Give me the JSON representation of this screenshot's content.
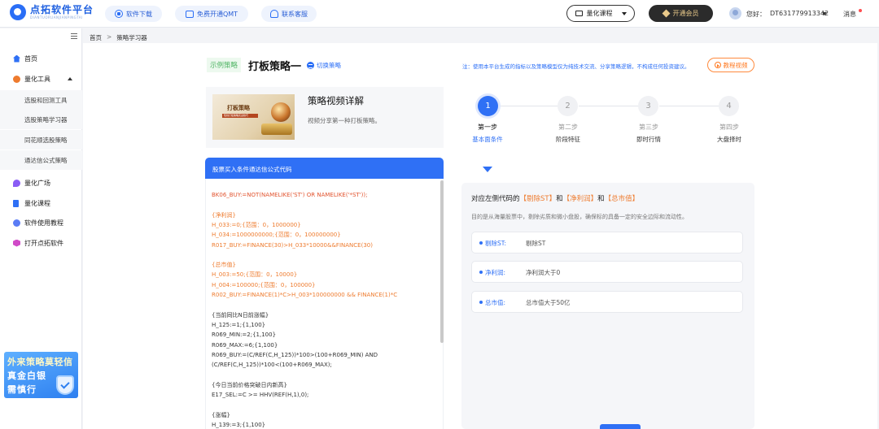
{
  "brand": {
    "name": "点拓软件平台",
    "sub": "DIANTUORUANJIANPINGTAI"
  },
  "topnav": {
    "download": "软件下载",
    "qmt": "免费开通QMT",
    "support": "联系客服",
    "course": "量化课程",
    "vip": "开通会员",
    "greeting": "您好：",
    "user_id": "DT631779913342",
    "messages": "消息"
  },
  "sidebar": {
    "items": [
      {
        "label": "首页",
        "icon": "home-icon"
      },
      {
        "label": "量化工具",
        "icon": "tools-icon"
      },
      {
        "label": "量化广场",
        "icon": "square-icon"
      },
      {
        "label": "量化课程",
        "icon": "book-icon"
      },
      {
        "label": "软件使用教程",
        "icon": "tutorial-icon"
      },
      {
        "label": "打开点拓软件",
        "icon": "open-app-icon"
      }
    ],
    "subitems": [
      "选股和回测工具",
      "选股策略学习器",
      "同花顺选股策略",
      "通达信公式策略"
    ],
    "promo": [
      "外来策略莫轻信",
      "真金白银",
      "需慎行"
    ]
  },
  "breadcrumb": {
    "home": "首页",
    "sep": ">",
    "current": "策略学习器"
  },
  "strategy": {
    "tag": "示例策略",
    "title": "打板策略一",
    "switch": "切换策略",
    "notice": "注：使用本平台生成的指标以及策略模型仅为纯技术交流、分享策略逻辑，不构成任何投资建议。",
    "tutorial": "教程视频"
  },
  "video": {
    "thumb_title": "打板策略",
    "thumb_sub": "短线打板策略实战技巧",
    "title": "策略视频详解",
    "desc": "视频分享第一种打板策略。"
  },
  "code": {
    "header": "股票买入条件通达信公式代码",
    "lines": [
      {
        "t": "BK06_BUY:=NOT(NAMELIKE('ST') OR NAMELIKE('*ST'));",
        "c": "red"
      },
      {
        "t": "",
        "c": "dark"
      },
      {
        "t": "{净利润}",
        "c": "org"
      },
      {
        "t": "H_033:=0;{范围：0，1000000}",
        "c": "org"
      },
      {
        "t": "H_034:=1000000000;{范围：0，100000000}",
        "c": "org"
      },
      {
        "t": "R017_BUY:=FINANCE(30)>H_033*10000&&FINANCE(30)",
        "c": "org"
      },
      {
        "t": "",
        "c": "dark"
      },
      {
        "t": "{总市值}",
        "c": "org"
      },
      {
        "t": "H_003:=50;{范围：0，10000}",
        "c": "org"
      },
      {
        "t": "H_004:=100000;{范围：0，100000}",
        "c": "org"
      },
      {
        "t": "R002_BUY:=FINANCE(1)*C>H_003*100000000 && FINANCE(1)*C",
        "c": "org"
      },
      {
        "t": "",
        "c": "dark"
      },
      {
        "t": "{当前同比N日前涨幅}",
        "c": "dark"
      },
      {
        "t": "H_125:=1;{1,100}",
        "c": "dark"
      },
      {
        "t": "R069_MIN:=2;{1,100}",
        "c": "dark"
      },
      {
        "t": "R069_MAX:=6;{1,100}",
        "c": "dark"
      },
      {
        "t": "R069_BUY:=(C/REF(C,H_125))*100>(100+R069_MIN) AND",
        "c": "dark"
      },
      {
        "t": "(C/REF(C,H_125))*100<(100+R069_MAX);",
        "c": "dark"
      },
      {
        "t": "",
        "c": "dark"
      },
      {
        "t": "{今日当前价格突破日内新高}",
        "c": "dark"
      },
      {
        "t": "E17_SEL:=C >= HHV(REF(H,1),0);",
        "c": "dark"
      },
      {
        "t": "",
        "c": "dark"
      },
      {
        "t": "{涨幅}",
        "c": "dark"
      },
      {
        "t": "H_139:=3;{1,100}",
        "c": "dark"
      }
    ]
  },
  "steps": [
    {
      "num": "1",
      "name": "第一步",
      "sub": "基本面条件",
      "active": true
    },
    {
      "num": "2",
      "name": "第二步",
      "sub": "阶段特征",
      "active": false
    },
    {
      "num": "3",
      "name": "第三步",
      "sub": "即时行情",
      "active": false
    },
    {
      "num": "4",
      "name": "第四步",
      "sub": "大盘择时",
      "active": false
    }
  ],
  "detail": {
    "title_prefix": "对应左侧代码的",
    "hl1": "【剔除ST】",
    "and1": "和",
    "hl2": "【净利润】",
    "and2": "和",
    "hl3": "【总市值】",
    "desc": "目的是从海量股票中，剔除劣质和微小盘股，确保标的具备一定的安全边际和流动性。",
    "conditions": [
      {
        "key": "剔除ST:",
        "value": "剔除ST"
      },
      {
        "key": "净利润:",
        "value": "净利润大于0"
      },
      {
        "key": "总市值:",
        "value": "总市值大于50亿"
      }
    ]
  },
  "colors": {
    "primary": "#2f70f5",
    "accent": "#ee7b2e",
    "code_red": "#e2542f"
  }
}
